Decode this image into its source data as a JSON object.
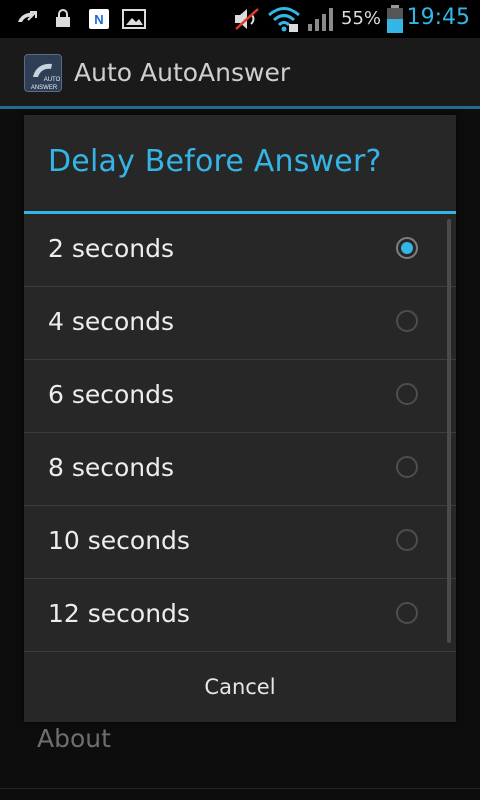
{
  "status_bar": {
    "battery_percent": "55%",
    "time": "19:45",
    "left_icons": [
      "missed-call-icon",
      "lock-icon",
      "n-app-icon",
      "image-icon"
    ],
    "right_icons": [
      "muted-speaker-icon",
      "wifi-icon",
      "signal-icon",
      "battery-icon"
    ]
  },
  "action_bar": {
    "app_title": "Auto AutoAnswer",
    "icon_text_1": "AUTO",
    "icon_text_2": "ANSWER"
  },
  "background": {
    "about_label": "About"
  },
  "dialog": {
    "title": "Delay Before Answer?",
    "selected_index": 0,
    "options": [
      {
        "label": "2 seconds"
      },
      {
        "label": "4 seconds"
      },
      {
        "label": "6 seconds"
      },
      {
        "label": "8 seconds"
      },
      {
        "label": "10 seconds"
      },
      {
        "label": "12 seconds"
      }
    ],
    "cancel_label": "Cancel"
  },
  "colors": {
    "accent": "#33b5e5",
    "background": "#0d0d0d",
    "dialog_background": "#272727"
  }
}
